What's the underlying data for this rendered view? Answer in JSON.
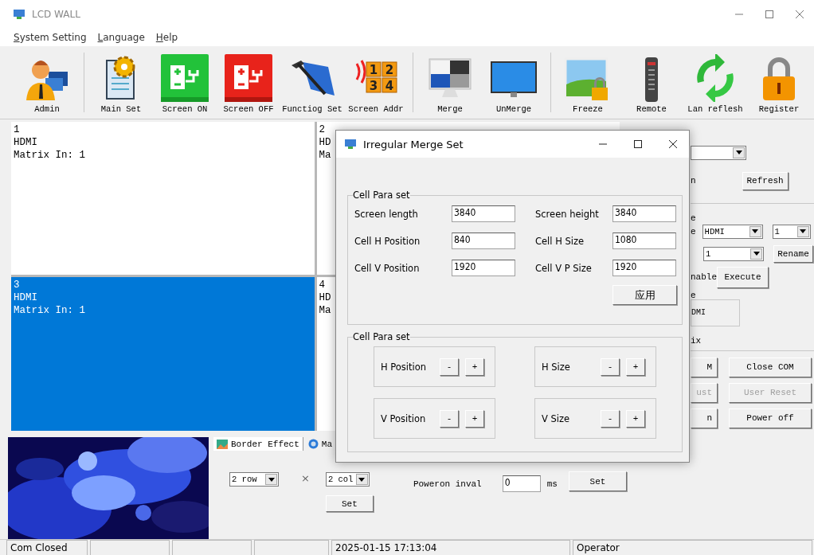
{
  "window": {
    "title": "LCD WALL"
  },
  "menu": [
    {
      "label": "System Setting"
    },
    {
      "label": "Language"
    },
    {
      "label": "Help"
    }
  ],
  "toolbar": [
    {
      "label": "Admin",
      "separator_after": true
    },
    {
      "label": "Main Set",
      "separator_after": false
    },
    {
      "label": "Screen ON",
      "separator_after": false
    },
    {
      "label": "Screen OFF",
      "separator_after": false
    },
    {
      "label": "Functiog Set",
      "separator_after": false
    },
    {
      "label": "Screen Addr",
      "separator_after": true,
      "digits": [
        "1",
        "2",
        "3",
        "4"
      ]
    },
    {
      "label": "Merge",
      "separator_after": false
    },
    {
      "label": "UnMerge",
      "separator_after": true
    },
    {
      "label": "Freeze",
      "separator_after": false
    },
    {
      "label": "Remote",
      "separator_after": false
    },
    {
      "label": "Lan reflesh",
      "separator_after": false
    },
    {
      "label": "Register",
      "separator_after": false
    }
  ],
  "cells": [
    {
      "number": "1",
      "source": "HDMI",
      "matrix": "Matrix In: 1",
      "selected": false
    },
    {
      "number": "2",
      "source": "HD",
      "matrix": "Ma",
      "selected": false
    },
    {
      "number": "3",
      "source": "HDMI",
      "matrix": "Matrix In: 1",
      "selected": true
    },
    {
      "number": "4",
      "source": "HD",
      "matrix": "Ma",
      "selected": false
    }
  ],
  "right_panel": {
    "refresh_label": "n",
    "refresh_button": "Refresh",
    "group_label": "e",
    "source_label": "e",
    "source_value": "HDMI",
    "source_index": "1",
    "output_value": "1",
    "rename_button": "Rename",
    "enable_label": "nable",
    "execute_button": "Execute",
    "box_label": "e",
    "box_value": "DMI",
    "matrix_label": "ix",
    "buttons": [
      {
        "label": "M",
        "disabled": false
      },
      {
        "label": "Close COM",
        "disabled": false
      },
      {
        "label": "ust",
        "disabled": true
      },
      {
        "label": "User Reset",
        "disabled": true
      },
      {
        "label": "n",
        "disabled": false
      },
      {
        "label": "Power off",
        "disabled": false
      }
    ]
  },
  "bottom": {
    "tabs": [
      {
        "label": "Border Effect",
        "selected": true
      },
      {
        "label": "Ma",
        "selected": false
      }
    ],
    "rows_value": "2 row",
    "times": "×",
    "cols_value": "2 col",
    "set_button": "Set",
    "poweron_label": "Poweron inval",
    "poweron_value": "0",
    "unit": "ms",
    "poweron_set": "Set"
  },
  "dialog": {
    "title": "Irregular Merge Set",
    "group1": {
      "title": "Cell Para set",
      "fields": [
        {
          "label": "Screen length",
          "value": "3840"
        },
        {
          "label": "Screen height",
          "value": "3840"
        },
        {
          "label": "Cell H Position",
          "value": "840"
        },
        {
          "label": "Cell H Size",
          "value": "1080"
        },
        {
          "label": "Cell V Position",
          "value": "1920"
        },
        {
          "label": "Cell V P Size",
          "value": "1920"
        }
      ],
      "apply": "应用"
    },
    "group2": {
      "title": "Cell Para set",
      "adjusters": [
        {
          "label": "H Position",
          "minus": "-",
          "plus": "+"
        },
        {
          "label": "H Size",
          "minus": "-",
          "plus": "+"
        },
        {
          "label": "V Position",
          "minus": "-",
          "plus": "+"
        },
        {
          "label": "V Size",
          "minus": "-",
          "plus": "+"
        }
      ]
    }
  },
  "status_bar": {
    "connection": "Com Closed",
    "time": "2025-01-15 17:13:04",
    "user": "Operator"
  }
}
